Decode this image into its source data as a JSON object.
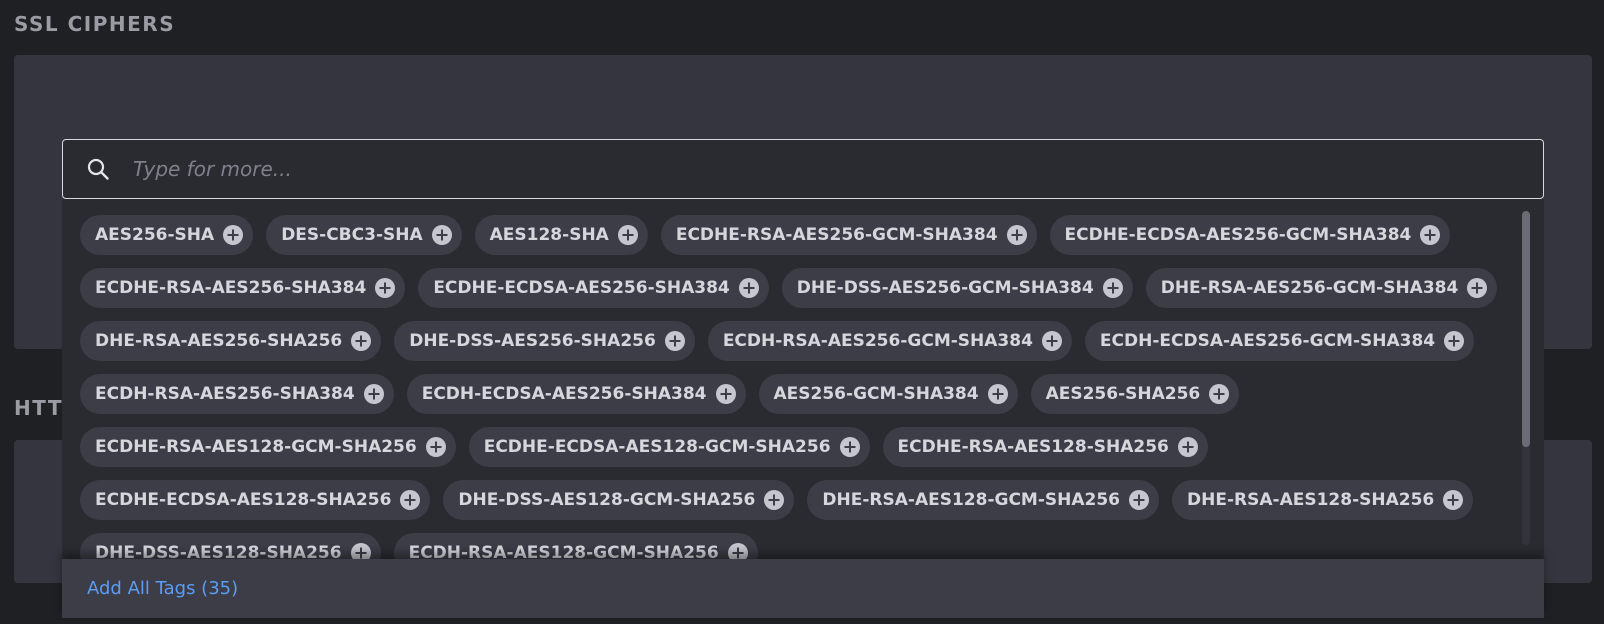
{
  "sections": {
    "ssl_title": "SSL CIPHERS",
    "http_title": "HTT"
  },
  "search": {
    "placeholder": "Type for more..."
  },
  "tags": [
    "AES256-SHA",
    "DES-CBC3-SHA",
    "AES128-SHA",
    "ECDHE-RSA-AES256-GCM-SHA384",
    "ECDHE-ECDSA-AES256-GCM-SHA384",
    "ECDHE-RSA-AES256-SHA384",
    "ECDHE-ECDSA-AES256-SHA384",
    "DHE-DSS-AES256-GCM-SHA384",
    "DHE-RSA-AES256-GCM-SHA384",
    "DHE-RSA-AES256-SHA256",
    "DHE-DSS-AES256-SHA256",
    "ECDH-RSA-AES256-GCM-SHA384",
    "ECDH-ECDSA-AES256-GCM-SHA384",
    "ECDH-RSA-AES256-SHA384",
    "ECDH-ECDSA-AES256-SHA384",
    "AES256-GCM-SHA384",
    "AES256-SHA256",
    "ECDHE-RSA-AES128-GCM-SHA256",
    "ECDHE-ECDSA-AES128-GCM-SHA256",
    "ECDHE-RSA-AES128-SHA256",
    "ECDHE-ECDSA-AES128-SHA256",
    "DHE-DSS-AES128-GCM-SHA256",
    "DHE-RSA-AES128-GCM-SHA256",
    "DHE-RSA-AES128-SHA256",
    "DHE-DSS-AES128-SHA256",
    "ECDH-RSA-AES128-GCM-SHA256"
  ],
  "tag_icon": "plus-circle-icon",
  "footer": {
    "add_all_label": "Add All Tags (35)"
  },
  "colors": {
    "background": "#1f2023",
    "panel": "#34353e",
    "tag_bg": "#3c3d47",
    "link": "#5b9cf5"
  }
}
